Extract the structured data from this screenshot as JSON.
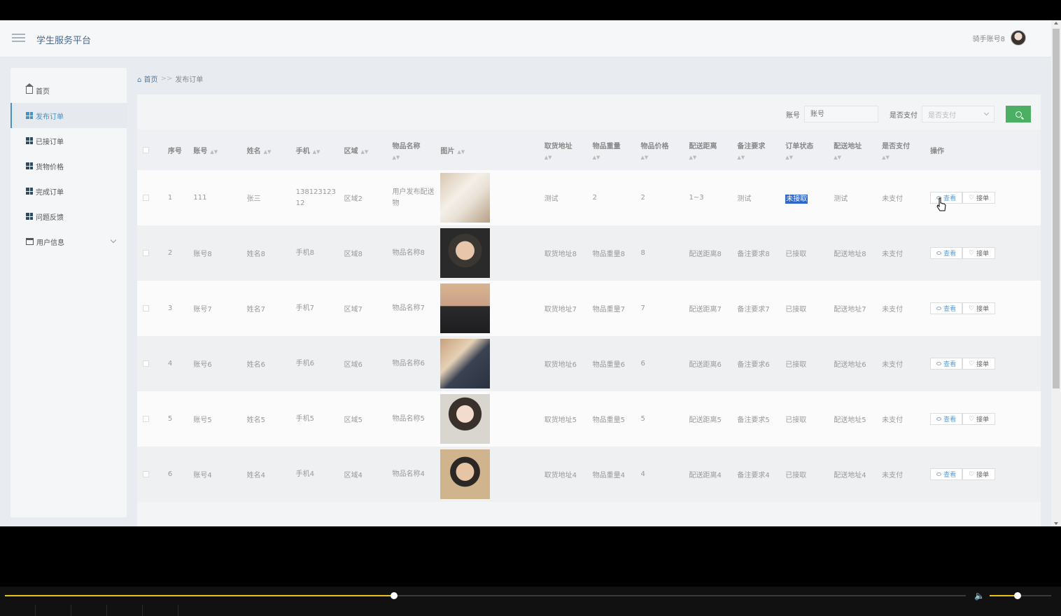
{
  "app": {
    "title": "学生服务平台",
    "user": "骑手账号8"
  },
  "sidebar": {
    "items": [
      {
        "label": "首页",
        "icon": "home-icon"
      },
      {
        "label": "发布订单",
        "icon": "grid-icon",
        "active": true
      },
      {
        "label": "已接订单",
        "icon": "grid-icon"
      },
      {
        "label": "货物价格",
        "icon": "grid-icon"
      },
      {
        "label": "完成订单",
        "icon": "grid-icon"
      },
      {
        "label": "问题反馈",
        "icon": "grid-icon"
      },
      {
        "label": "用户信息",
        "icon": "card-icon",
        "expandable": true
      }
    ]
  },
  "breadcrumb": {
    "home": "首页",
    "sep": ">>",
    "current": "发布订单"
  },
  "search": {
    "account_label": "账号",
    "account_placeholder": "账号",
    "paid_label": "是否支付",
    "paid_placeholder": "是否支付"
  },
  "table": {
    "headers": {
      "index": "序号",
      "account": "账号",
      "name": "姓名",
      "phone": "手机",
      "region": "区域",
      "item_name": "物品名称",
      "photo": "图片",
      "pickup": "取货地址",
      "weight": "物品重量",
      "price": "物品价格",
      "distance": "配送距离",
      "remark": "备注要求",
      "status": "订单状态",
      "delivery": "配送地址",
      "paid": "是否支付",
      "actions": "操作"
    },
    "view_label": "查看",
    "accept_label": "接单",
    "rows": [
      {
        "index": "1",
        "account": "111",
        "name": "张三",
        "phone": "13812312312",
        "region": "区域2",
        "item_name": "用户发布配送物",
        "pickup": "测试",
        "weight": "2",
        "price": "2",
        "distance": "1~3",
        "remark": "测试",
        "status": "未接取",
        "delivery": "测试",
        "paid": "未支付"
      },
      {
        "index": "2",
        "account": "账号8",
        "name": "姓名8",
        "phone": "手机8",
        "region": "区域8",
        "item_name": "物品名称8",
        "pickup": "取货地址8",
        "weight": "物品重量8",
        "price": "8",
        "distance": "配送距离8",
        "remark": "备注要求8",
        "status": "已接取",
        "delivery": "配送地址8",
        "paid": "未支付"
      },
      {
        "index": "3",
        "account": "账号7",
        "name": "姓名7",
        "phone": "手机7",
        "region": "区域7",
        "item_name": "物品名称7",
        "pickup": "取货地址7",
        "weight": "物品重量7",
        "price": "7",
        "distance": "配送距离7",
        "remark": "备注要求7",
        "status": "已接取",
        "delivery": "配送地址7",
        "paid": "未支付"
      },
      {
        "index": "4",
        "account": "账号6",
        "name": "姓名6",
        "phone": "手机6",
        "region": "区域6",
        "item_name": "物品名称6",
        "pickup": "取货地址6",
        "weight": "物品重量6",
        "price": "6",
        "distance": "配送距离6",
        "remark": "备注要求6",
        "status": "已接取",
        "delivery": "配送地址6",
        "paid": "未支付"
      },
      {
        "index": "5",
        "account": "账号5",
        "name": "姓名5",
        "phone": "手机5",
        "region": "区域5",
        "item_name": "物品名称5",
        "pickup": "取货地址5",
        "weight": "物品重量5",
        "price": "5",
        "distance": "配送距离5",
        "remark": "备注要求5",
        "status": "已接取",
        "delivery": "配送地址5",
        "paid": "未支付"
      },
      {
        "index": "6",
        "account": "账号4",
        "name": "姓名4",
        "phone": "手机4",
        "region": "区域4",
        "item_name": "物品名称4",
        "pickup": "取货地址4",
        "weight": "物品重量4",
        "price": "4",
        "distance": "配送距离4",
        "remark": "备注要求4",
        "status": "已接取",
        "delivery": "配送地址4",
        "paid": "未支付"
      }
    ]
  },
  "player": {
    "progress": 0.405,
    "volume": 0.45
  },
  "colors": {
    "accent": "#4a90c0",
    "search_button": "#4caf63",
    "progress": "#e6c21a",
    "highlight": "#2d67c8"
  }
}
